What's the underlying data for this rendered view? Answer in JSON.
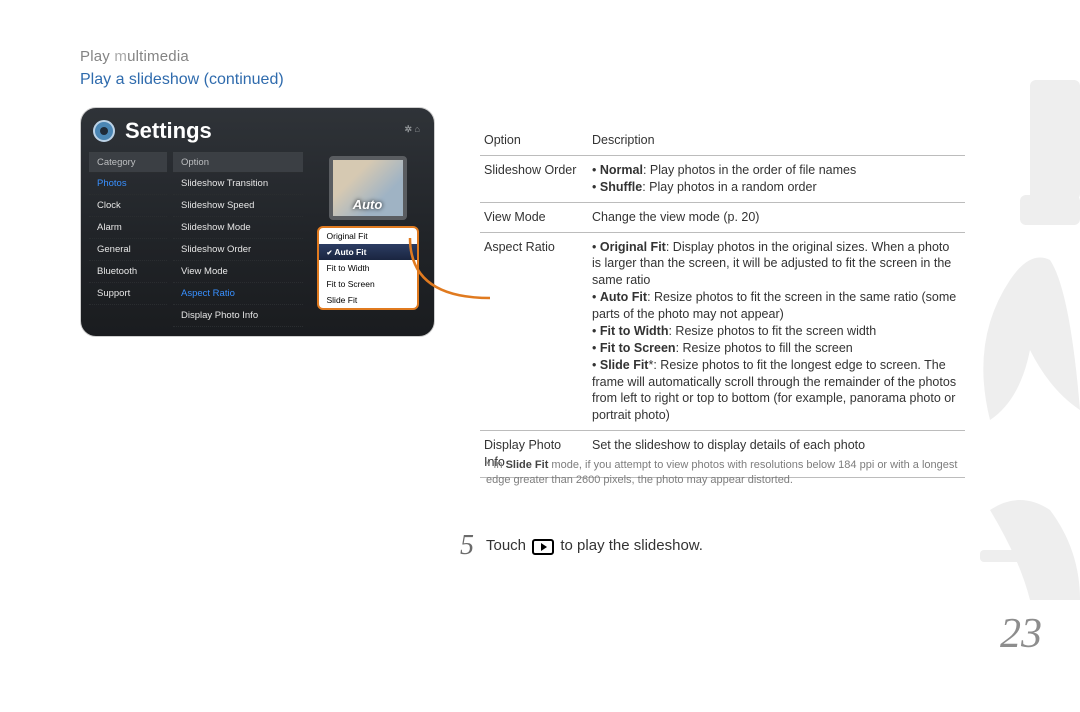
{
  "breadcrumb": {
    "prefix": "Play ",
    "m": "m",
    "rest": "ultimedia"
  },
  "section_title": "Play a slideshow  (continued)",
  "settings": {
    "title": "Settings",
    "preview_label": "Auto",
    "headers": {
      "category": "Category",
      "option": "Option"
    },
    "categories": [
      {
        "label": "Photos",
        "sel": true
      },
      {
        "label": "Clock",
        "sel": false
      },
      {
        "label": "Alarm",
        "sel": false
      },
      {
        "label": "General",
        "sel": false
      },
      {
        "label": "Bluetooth",
        "sel": false
      },
      {
        "label": "Support",
        "sel": false
      }
    ],
    "options_col": [
      {
        "label": "Slideshow Transition",
        "sel": false
      },
      {
        "label": "Slideshow Speed",
        "sel": false
      },
      {
        "label": "Slideshow Mode",
        "sel": false
      },
      {
        "label": "Slideshow Order",
        "sel": false
      },
      {
        "label": "View Mode",
        "sel": false
      },
      {
        "label": "Aspect Ratio",
        "sel": true
      },
      {
        "label": "Display Photo Info",
        "sel": false
      }
    ],
    "aspect_list": [
      {
        "label": "Original Fit",
        "selected": false
      },
      {
        "label": "Auto Fit",
        "selected": true
      },
      {
        "label": "Fit to Width",
        "selected": false
      },
      {
        "label": "Fit to Screen",
        "selected": false
      },
      {
        "label": "Slide Fit",
        "selected": false
      }
    ]
  },
  "table": {
    "head": {
      "option": "Option",
      "description": "Description"
    },
    "rows": [
      {
        "option": "Slideshow Order",
        "desc": [
          {
            "b": "Normal",
            "t": ": Play photos in the order of file names"
          },
          {
            "b": "Shuffle",
            "t": ": Play photos in a random order"
          }
        ]
      },
      {
        "option": "View Mode",
        "plain": "Change the view mode (p. 20)"
      },
      {
        "option": "Aspect Ratio",
        "desc": [
          {
            "b": "Original Fit",
            "t": ": Display photos in the original sizes. When a photo is larger than the screen, it will be adjusted to fit the screen in the same ratio"
          },
          {
            "b": "Auto Fit",
            "t": ": Resize photos to fit the screen in the same ratio (some parts of the photo may not appear)"
          },
          {
            "b": "Fit to Width",
            "t": ": Resize photos to fit the screen width"
          },
          {
            "b": "Fit to Screen",
            "t": ": Resize photos to fill the screen"
          },
          {
            "b": "Slide Fit",
            "sup": "*",
            "t": ": Resize photos to fit the longest edge to screen. The frame will automatically scroll through the remainder of the photos from left to right or top to bottom (for example, panorama photo or portrait photo)"
          }
        ]
      },
      {
        "option": "Display Photo Info",
        "plain": "Set the slideshow to display details of each photo"
      }
    ]
  },
  "footnote": {
    "star": "* In ",
    "bold": "Slide Fit",
    "rest": " mode, if you attempt to view photos with resolutions below 184 ppi or with a longest edge greater than 2600 pixels, the photo may appear distorted."
  },
  "step": {
    "num": "5",
    "before": "Touch ",
    "after": " to play the slideshow."
  },
  "page_num": "23"
}
